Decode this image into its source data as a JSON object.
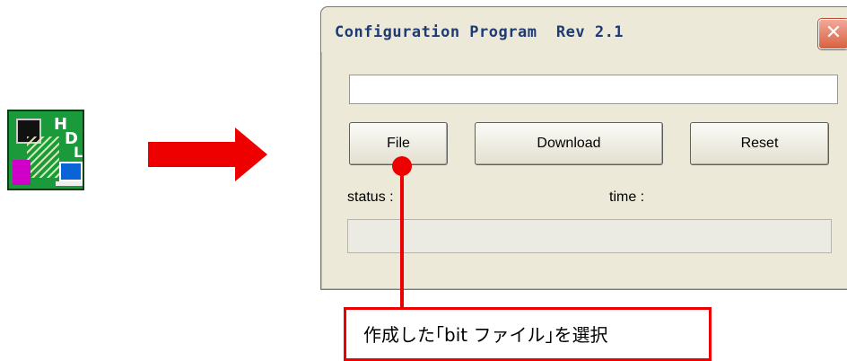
{
  "window": {
    "title": "Configuration Program  Rev 2.1",
    "close_label": "✕"
  },
  "file_path": {
    "value": ""
  },
  "buttons": {
    "file": "File",
    "download": "Download",
    "reset": "Reset"
  },
  "labels": {
    "status": "status :",
    "time": "time :"
  },
  "progress": {
    "value": 0
  },
  "app_icon": {
    "name": "hdl-board-icon",
    "letters": [
      "H",
      "D",
      "L"
    ]
  },
  "annotation": {
    "text": "作成した｢bit ファイル｣を選択",
    "color": "#ee0000"
  }
}
